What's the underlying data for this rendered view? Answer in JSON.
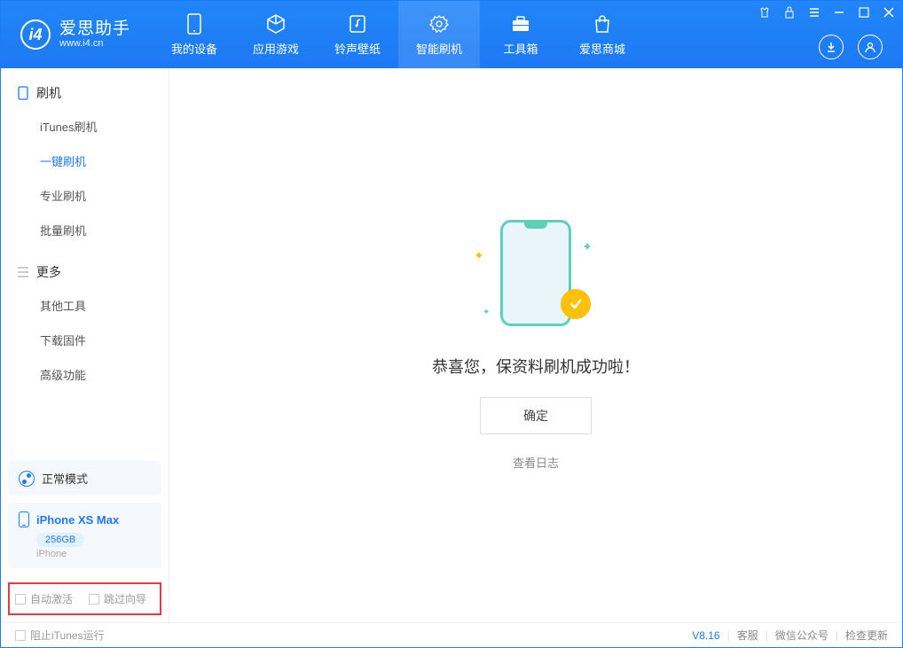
{
  "app": {
    "title": "爱思助手",
    "subtitle": "www.i4.cn"
  },
  "tabs": [
    {
      "id": "device",
      "label": "我的设备",
      "icon": "device-icon"
    },
    {
      "id": "apps",
      "label": "应用游戏",
      "icon": "cube-icon"
    },
    {
      "id": "ring",
      "label": "铃声壁纸",
      "icon": "note-icon"
    },
    {
      "id": "flash",
      "label": "智能刷机",
      "icon": "gear-icon",
      "active": true
    },
    {
      "id": "toolbox",
      "label": "工具箱",
      "icon": "briefcase-icon"
    },
    {
      "id": "store",
      "label": "爱思商城",
      "icon": "bag-icon"
    }
  ],
  "sidebar": {
    "group_flash": {
      "title": "刷机",
      "items": [
        {
          "id": "itunes",
          "label": "iTunes刷机"
        },
        {
          "id": "oneclick",
          "label": "一键刷机",
          "active": true
        },
        {
          "id": "pro",
          "label": "专业刷机"
        },
        {
          "id": "batch",
          "label": "批量刷机"
        }
      ]
    },
    "group_more": {
      "title": "更多",
      "items": [
        {
          "id": "other",
          "label": "其他工具"
        },
        {
          "id": "firmware",
          "label": "下载固件"
        },
        {
          "id": "advanced",
          "label": "高级功能"
        }
      ]
    },
    "mode_label": "正常模式",
    "device": {
      "name": "iPhone XS Max",
      "storage": "256GB",
      "type": "iPhone"
    },
    "checks": {
      "auto_activate": "自动激活",
      "skip_setup": "跳过向导"
    }
  },
  "main": {
    "message": "恭喜您，保资料刷机成功啦！",
    "ok": "确定",
    "view_log": "查看日志"
  },
  "footer": {
    "block_itunes": "阻止iTunes运行",
    "version": "V8.16",
    "support": "客服",
    "wechat": "微信公众号",
    "update": "检查更新"
  }
}
